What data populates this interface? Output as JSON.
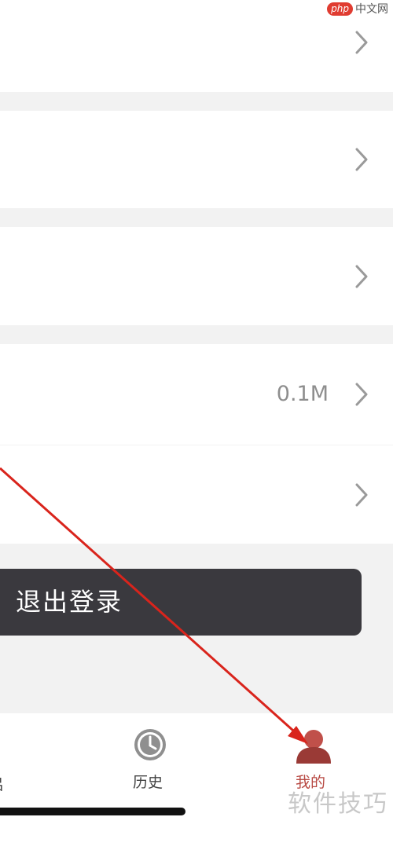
{
  "settings": {
    "rows": [
      {
        "id": "row1",
        "value": ""
      },
      {
        "id": "row2",
        "value": ""
      },
      {
        "id": "row3",
        "value": ""
      },
      {
        "id": "row4",
        "value": "0.1M"
      },
      {
        "id": "row5",
        "value": ""
      }
    ],
    "logout_label": "退出登录"
  },
  "tabbar": {
    "tabs": [
      {
        "label": "历史",
        "icon": "clock-icon",
        "active": false
      },
      {
        "label": "我的",
        "icon": "user-icon",
        "active": true
      }
    ],
    "active_color": "#b84a44",
    "inactive_color": "#444444"
  },
  "watermarks": {
    "top_badge": "php",
    "top_text": "中文网",
    "bottom_text": "软件技巧"
  },
  "annotation": {
    "arrow_color": "#d9241c"
  }
}
